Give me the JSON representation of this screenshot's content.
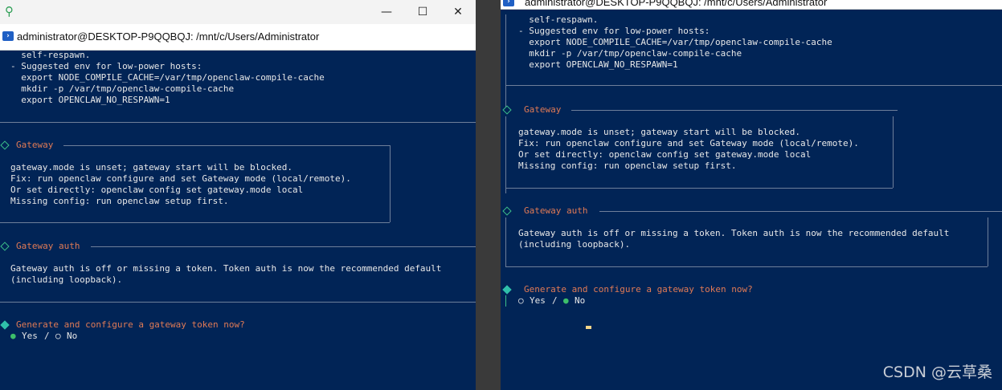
{
  "left_window": {
    "tab_title": "administrator@DESKTOP-P9QQBQJ: /mnt/c/Users/Administrator",
    "controls": {
      "minimize": "—",
      "maximize": "☐",
      "close": "✕"
    },
    "top_lines": [
      "  self-respawn.",
      "- Suggested env for low-power hosts:",
      "  export NODE_COMPILE_CACHE=/var/tmp/openclaw-compile-cache",
      "  mkdir -p /var/tmp/openclaw-compile-cache",
      "  export OPENCLAW_NO_RESPAWN=1"
    ],
    "gateway": {
      "title": "Gateway",
      "lines": [
        "gateway.mode is unset; gateway start will be blocked.",
        "Fix: run openclaw configure and set Gateway mode (local/remote).",
        "Or set directly: openclaw config set gateway.mode local",
        "Missing config: run openclaw setup first."
      ]
    },
    "auth": {
      "title": "Gateway auth",
      "lines": [
        "Gateway auth is off or missing a token. Token auth is now the recommended default",
        "(including loopback)."
      ]
    },
    "prompt": {
      "question": "Generate and configure a gateway token now?",
      "yes_marker": "●",
      "yes": "Yes",
      "separator": "/",
      "no_marker": "○",
      "no": "No"
    }
  },
  "right_window": {
    "tab_title": "administrator@DESKTOP-P9QQBQJ: /mnt/c/Users/Administrator",
    "top_lines": [
      "  self-respawn.",
      "- Suggested env for low-power hosts:",
      "  export NODE_COMPILE_CACHE=/var/tmp/openclaw-compile-cache",
      "  mkdir -p /var/tmp/openclaw-compile-cache",
      "  export OPENCLAW_NO_RESPAWN=1"
    ],
    "gateway": {
      "title": "Gateway",
      "lines": [
        "gateway.mode is unset; gateway start will be blocked.",
        "Fix: run openclaw configure and set Gateway mode (local/remote).",
        "Or set directly: openclaw config set gateway.mode local",
        "Missing config: run openclaw setup first."
      ]
    },
    "auth": {
      "title": "Gateway auth",
      "lines": [
        "Gateway auth is off or missing a token. Token auth is now the recommended default",
        "(including loopback)."
      ]
    },
    "prompt": {
      "question": "Generate and configure a gateway token now?",
      "yes_marker": "○",
      "yes": "Yes",
      "separator": "/",
      "no_marker": "●",
      "no": "No"
    }
  },
  "watermark": "CSDN @云草桑",
  "colors": {
    "terminal_bg": "#012456",
    "accent_orange": "#e07a55",
    "accent_green": "#3dbf8a",
    "text": "#e8e8e8"
  }
}
